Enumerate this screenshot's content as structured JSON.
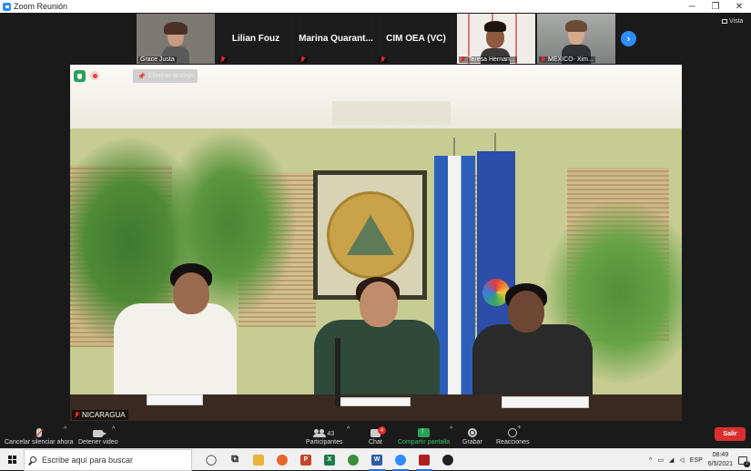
{
  "window": {
    "title": "Zoom Reunión"
  },
  "strip": {
    "participants": [
      {
        "name": "Grace Justa",
        "type": "video"
      },
      {
        "name": "Lilian Fouz",
        "type": "name"
      },
      {
        "name": "Marina  Quarant...",
        "type": "name"
      },
      {
        "name": "CIM OEA (VC)",
        "type": "name"
      },
      {
        "name": "Teresa Hernan...",
        "type": "video"
      },
      {
        "name": "MEXICO- Xim...",
        "type": "video"
      }
    ],
    "view_label": "Vista"
  },
  "main": {
    "unpin_label": "Eliminar anclaje",
    "speaker_name": "NICARAGUA",
    "seal_text": "REPUBLICA DE NICARAGUA · AMERICA CENTRAL"
  },
  "controls": {
    "unmute_label": "Cancelar silenciar ahora",
    "video_label": "Detener video",
    "participants_label": "Participantes",
    "participants_count": "43",
    "chat_label": "Chat",
    "chat_badge": "4",
    "share_label": "Compartir pantalla",
    "record_label": "Grabar",
    "reactions_label": "Reacciones",
    "leave_label": "Salir"
  },
  "taskbar": {
    "search_placeholder": "Escribe aquí para buscar",
    "apps": [
      {
        "name": "cortana-icon",
        "color": "#1a1a1a",
        "glyph": "◯"
      },
      {
        "name": "task-view-icon",
        "color": "#1a1a1a",
        "glyph": "⧉"
      },
      {
        "name": "file-explorer-icon",
        "color": "#e8b53a",
        "glyph": ""
      },
      {
        "name": "firefox-icon",
        "color": "#e8672a",
        "glyph": ""
      },
      {
        "name": "powerpoint-icon",
        "color": "#c8452b",
        "glyph": "P"
      },
      {
        "name": "excel-icon",
        "color": "#1f7a44",
        "glyph": "X"
      },
      {
        "name": "chrome-icon",
        "color": "#3a8f3a",
        "glyph": ""
      },
      {
        "name": "word-icon",
        "color": "#2b5aa8",
        "glyph": "W"
      },
      {
        "name": "zoom-icon",
        "color": "#2d8cff",
        "glyph": ""
      },
      {
        "name": "media-app-icon",
        "color": "#b01e1e",
        "glyph": ""
      },
      {
        "name": "github-icon",
        "color": "#222222",
        "glyph": ""
      }
    ],
    "language": "ESP",
    "time": "08:49",
    "date": "6/5/2021",
    "notifications": "2"
  }
}
